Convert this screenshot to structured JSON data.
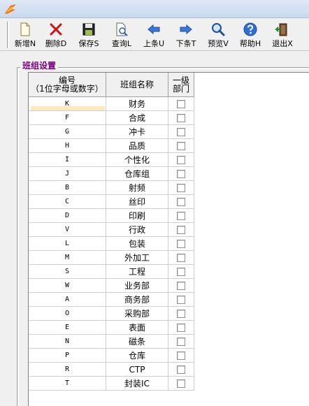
{
  "toolbar": {
    "buttons": [
      {
        "id": "new",
        "label": "新增N",
        "icon": "new-document-icon"
      },
      {
        "id": "delete",
        "label": "删除D",
        "icon": "delete-x-icon"
      },
      {
        "id": "save",
        "label": "保存S",
        "icon": "save-disk-icon"
      },
      {
        "id": "query",
        "label": "查询L",
        "icon": "query-document-icon"
      },
      {
        "id": "prev",
        "label": "上条U",
        "icon": "arrow-left-icon"
      },
      {
        "id": "next",
        "label": "下条T",
        "icon": "arrow-right-icon"
      },
      {
        "id": "preview",
        "label": "预览V",
        "icon": "magnifier-icon"
      },
      {
        "id": "help",
        "label": "帮助H",
        "icon": "help-icon"
      },
      {
        "id": "exit",
        "label": "退出X",
        "icon": "exit-door-icon"
      }
    ]
  },
  "group": {
    "title": "班组设置"
  },
  "grid": {
    "headers": {
      "code_line1": "编号",
      "code_line2": "（1位字母或数字）",
      "name": "班组名称",
      "level1_line1": "一级",
      "level1_line2": "部门"
    },
    "rows": [
      {
        "code": "K",
        "name": "财务",
        "level1": false
      },
      {
        "code": "F",
        "name": "合成",
        "level1": false
      },
      {
        "code": "G",
        "name": "冲卡",
        "level1": false
      },
      {
        "code": "H",
        "name": "品质",
        "level1": false
      },
      {
        "code": "I",
        "name": "个性化",
        "level1": false
      },
      {
        "code": "J",
        "name": "仓库组",
        "level1": false
      },
      {
        "code": "B",
        "name": "射频",
        "level1": false
      },
      {
        "code": "C",
        "name": "丝印",
        "level1": false
      },
      {
        "code": "D",
        "name": "印刷",
        "level1": false
      },
      {
        "code": "V",
        "name": "行政",
        "level1": false
      },
      {
        "code": "L",
        "name": "包装",
        "level1": false
      },
      {
        "code": "M",
        "name": "外加工",
        "level1": false
      },
      {
        "code": "S",
        "name": "工程",
        "level1": false
      },
      {
        "code": "W",
        "name": "业务部",
        "level1": false
      },
      {
        "code": "A",
        "name": "商务部",
        "level1": false
      },
      {
        "code": "O",
        "name": "采购部",
        "level1": false
      },
      {
        "code": "E",
        "name": "表面",
        "level1": false
      },
      {
        "code": "N",
        "name": "磁条",
        "level1": false
      },
      {
        "code": "P",
        "name": "仓库",
        "level1": false
      },
      {
        "code": "R",
        "name": "CTP",
        "level1": false
      },
      {
        "code": "T",
        "name": "封装IC",
        "level1": false
      }
    ]
  },
  "colors": {
    "group_title": "#7a0080",
    "edit_highlight": "#fde9c0"
  }
}
